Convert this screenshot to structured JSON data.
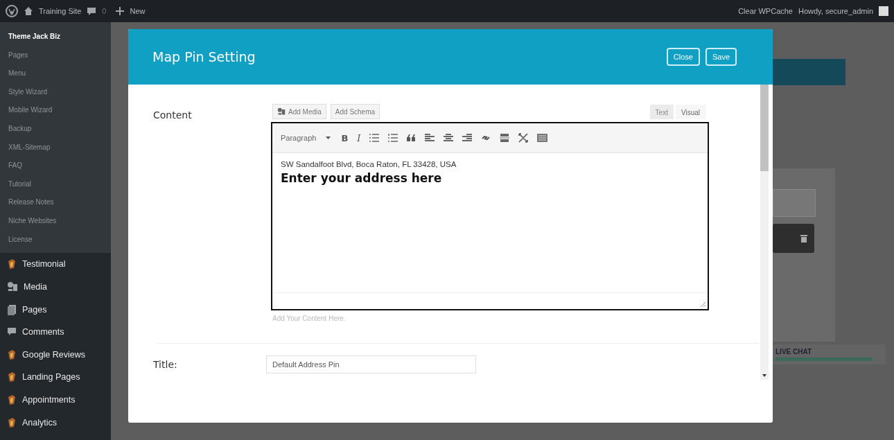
{
  "admin_bar": {
    "site_name": "Training Site",
    "comment_count": "0",
    "new_label": "New",
    "clear_cache": "Clear WPCache",
    "greeting": "Howdy, secure_admin"
  },
  "sidebar": {
    "submenu": [
      {
        "label": "Theme Jack Biz",
        "selected": true
      },
      {
        "label": "Pages",
        "selected": false
      },
      {
        "label": "Menu",
        "selected": false
      },
      {
        "label": "Style Wizard",
        "selected": false
      },
      {
        "label": "Mobile Wizard",
        "selected": false
      },
      {
        "label": "Backup",
        "selected": false
      },
      {
        "label": "XML-Sitemap",
        "selected": false
      },
      {
        "label": "FAQ",
        "selected": false
      },
      {
        "label": "Tutorial",
        "selected": false
      },
      {
        "label": "Release Notes",
        "selected": false
      },
      {
        "label": "Niche Websites",
        "selected": false
      },
      {
        "label": "License",
        "selected": false
      }
    ],
    "items": [
      {
        "label": "Testimonial",
        "kind": "plugin"
      },
      {
        "label": "Media",
        "kind": "media"
      },
      {
        "label": "Pages",
        "kind": "pages"
      },
      {
        "label": "Comments",
        "kind": "comments"
      },
      {
        "label": "Google Reviews",
        "kind": "plugin"
      },
      {
        "label": "Landing Pages",
        "kind": "plugin"
      },
      {
        "label": "Appointments",
        "kind": "plugin"
      },
      {
        "label": "Analytics",
        "kind": "plugin"
      }
    ]
  },
  "background": {
    "live_chat": "LIVE CHAT"
  },
  "modal": {
    "title": "Map Pin Setting",
    "buttons": [
      "Close",
      "Save"
    ],
    "content_label": "Content",
    "media_buttons": [
      {
        "label": "Add Media",
        "kind": "media"
      },
      {
        "label": "Add Schema",
        "kind": "plain"
      }
    ],
    "editor_tabs": [
      {
        "label": "Text",
        "selected": false
      },
      {
        "label": "Visual",
        "selected": true
      }
    ],
    "format_select": "Paragraph",
    "bold_label": "B",
    "italic_label": "I",
    "editor_content": [
      {
        "kind": "paragraph",
        "text": "SW Sandalfoot Blvd, Boca Raton, FL 33428, USA"
      },
      {
        "kind": "heading",
        "text": "Enter your address here"
      }
    ],
    "hint": "Add Your Content Here.",
    "title_label": "Title:",
    "title_value": "Default Address Pin"
  }
}
